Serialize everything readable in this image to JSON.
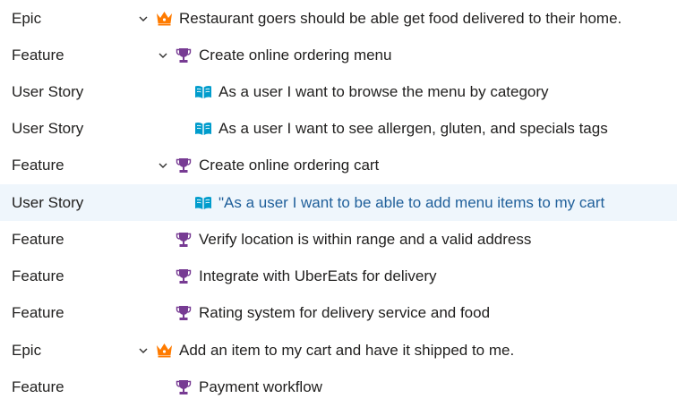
{
  "backlog": {
    "rows": [
      {
        "type": "Epic",
        "title": "Restaurant goers should be able get food delivered to their home.",
        "icon": "crown-icon",
        "expanded": true
      },
      {
        "type": "Feature",
        "title": "Create online ordering menu",
        "icon": "trophy-icon",
        "expanded": true
      },
      {
        "type": "User Story",
        "title": "As a user I want to browse the menu by category",
        "icon": "book-icon"
      },
      {
        "type": "User Story",
        "title": "As a user I want to see allergen, gluten, and specials tags",
        "icon": "book-icon"
      },
      {
        "type": "Feature",
        "title": "Create online ordering cart",
        "icon": "trophy-icon",
        "expanded": true
      },
      {
        "type": "User Story",
        "title": "\"As a user I want to be able to add menu items to my cart",
        "icon": "book-icon",
        "selected": true
      },
      {
        "type": "Feature",
        "title": "Verify location is within range and a valid address",
        "icon": "trophy-icon"
      },
      {
        "type": "Feature",
        "title": "Integrate with UberEats for delivery",
        "icon": "trophy-icon"
      },
      {
        "type": "Feature",
        "title": "Rating system for delivery service and food",
        "icon": "trophy-icon"
      },
      {
        "type": "Epic",
        "title": "Add an item to my cart and have it shipped to me.",
        "icon": "crown-icon",
        "expanded": true
      },
      {
        "type": "Feature",
        "title": "Payment workflow",
        "icon": "trophy-icon"
      }
    ]
  },
  "colors": {
    "epic_icon": "#ff7b00",
    "feature_icon": "#773b93",
    "story_icon": "#009ccc",
    "selected_row": "#eff6fc",
    "selected_text": "#1f5f9a"
  }
}
